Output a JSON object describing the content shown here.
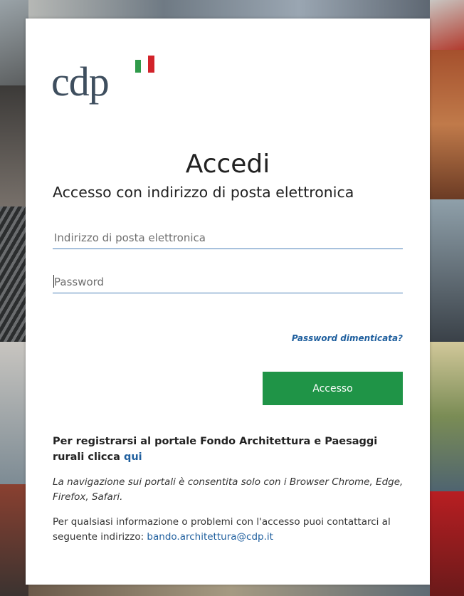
{
  "logo": {
    "text": "cdp"
  },
  "page": {
    "title": "Accedi",
    "subtitle": "Accesso con indirizzo di posta elettronica"
  },
  "form": {
    "email_placeholder": "Indirizzo di posta elettronica",
    "password_placeholder": "Password",
    "forgot_label": "Password dimenticata?",
    "submit_label": "Accesso"
  },
  "footer": {
    "register_text": "Per registrarsi al portale Fondo Architettura e Paesaggi rurali clicca",
    "register_link": "qui",
    "browser_note": "La navigazione sui portali è consentita solo con i Browser Chrome, Edge, Firefox, Safari.",
    "contact_text": "Per qualsiasi informazione o problemi con l'accesso puoi contattarci al seguente indirizzo:",
    "contact_email": "bando.architettura@cdp.it"
  },
  "colors": {
    "accent_green": "#1f9447",
    "link_blue": "#1f5f9e",
    "logo_slate": "#3e4e5e",
    "flag_green": "#2f9a4a",
    "flag_red": "#d2232a"
  }
}
